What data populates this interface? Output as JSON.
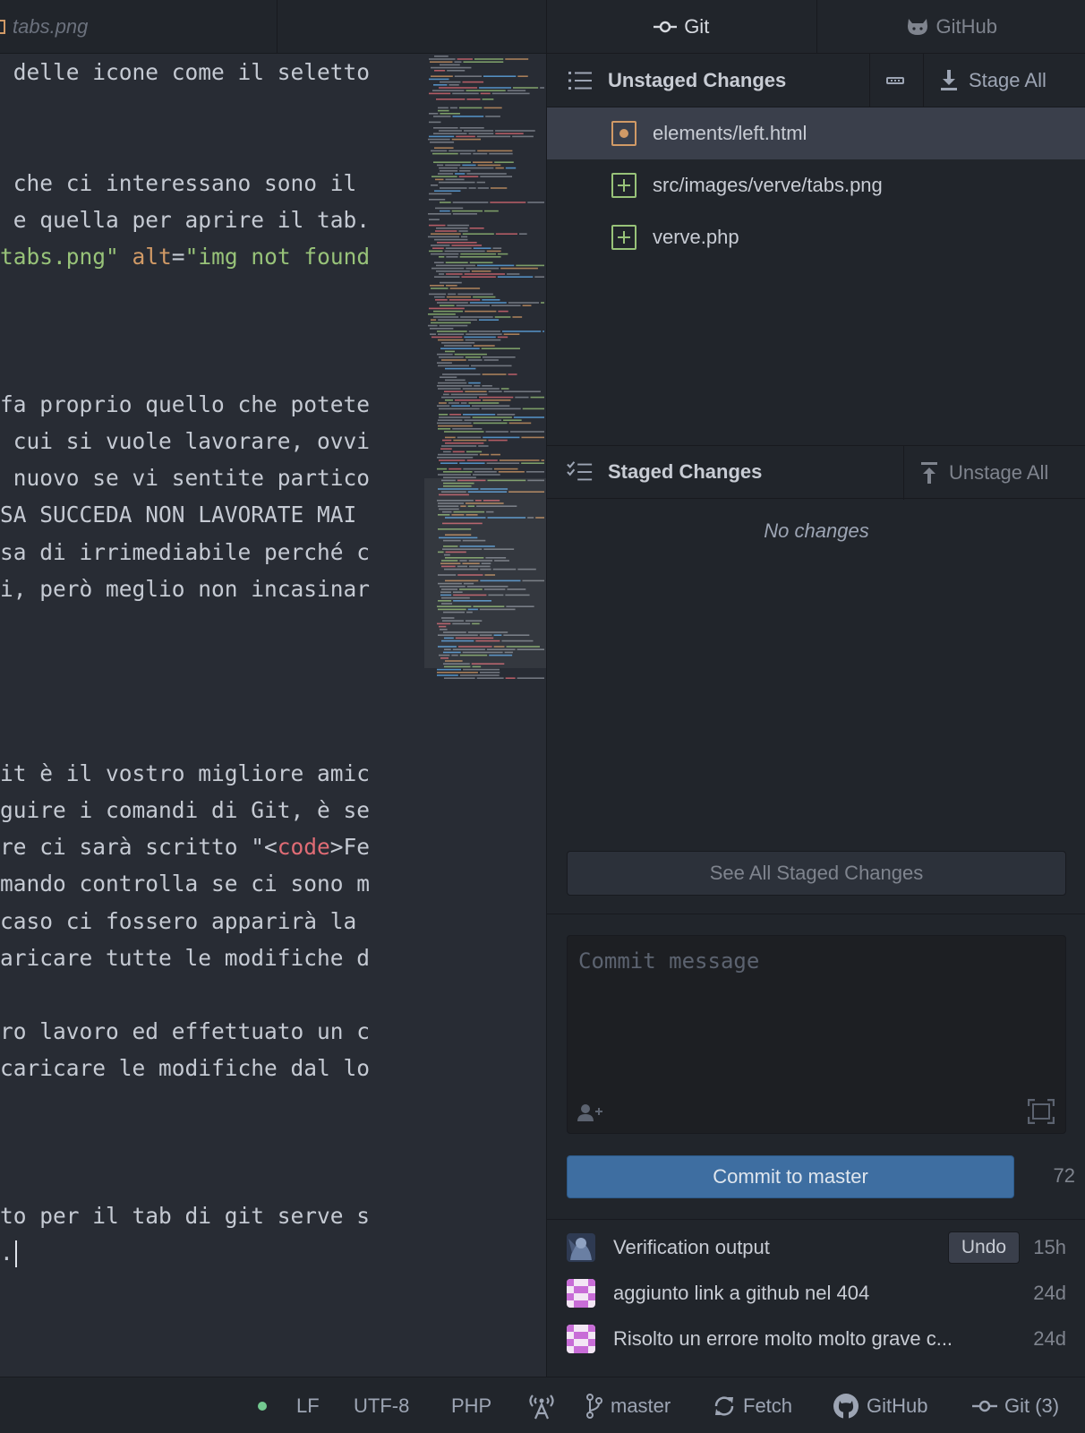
{
  "editor": {
    "tab_title": "tabs.png",
    "lines": [
      [
        {
          "t": " delle icone come il seletto",
          "c": "plain"
        }
      ],
      [
        {
          "t": "",
          "c": "plain"
        }
      ],
      [
        {
          "t": "",
          "c": "plain"
        }
      ],
      [
        {
          "t": " che ci interessano sono il ",
          "c": "plain"
        }
      ],
      [
        {
          "t": " e quella per aprire il tab.",
          "c": "plain"
        }
      ],
      [
        {
          "t": "tabs.png\"",
          "c": "green"
        },
        {
          "t": " ",
          "c": "plain"
        },
        {
          "t": "alt",
          "c": "orange"
        },
        {
          "t": "=",
          "c": "plain"
        },
        {
          "t": "\"img not found",
          "c": "green"
        }
      ],
      [
        {
          "t": "",
          "c": "plain"
        }
      ],
      [
        {
          "t": "",
          "c": "plain"
        }
      ],
      [
        {
          "t": "",
          "c": "plain"
        }
      ],
      [
        {
          "t": "fa proprio quello che potete",
          "c": "plain"
        }
      ],
      [
        {
          "t": " cui si vuole lavorare, ovvi",
          "c": "plain"
        }
      ],
      [
        {
          "t": " nuovo se vi sentite partico",
          "c": "plain"
        }
      ],
      [
        {
          "t": "SA SUCCEDA NON LAVORATE MAI ",
          "c": "plain"
        }
      ],
      [
        {
          "t": "sa di irrimediabile perché c",
          "c": "plain"
        }
      ],
      [
        {
          "t": "i, però meglio non incasinar",
          "c": "plain"
        }
      ],
      [
        {
          "t": "",
          "c": "plain"
        }
      ],
      [
        {
          "t": "",
          "c": "plain"
        }
      ],
      [
        {
          "t": "",
          "c": "plain"
        }
      ],
      [
        {
          "t": "",
          "c": "plain"
        }
      ],
      [
        {
          "t": "it è il vostro migliore amic",
          "c": "plain"
        }
      ],
      [
        {
          "t": "guire i comandi di Git, è se",
          "c": "plain"
        }
      ],
      [
        {
          "t": "re ci sarà scritto \"<",
          "c": "plain"
        },
        {
          "t": "code",
          "c": "red"
        },
        {
          "t": ">Fe",
          "c": "plain"
        }
      ],
      [
        {
          "t": "mando controlla se ci sono m",
          "c": "plain"
        }
      ],
      [
        {
          "t": "caso ci fossero apparirà la ",
          "c": "plain"
        }
      ],
      [
        {
          "t": "aricare tutte le modifiche d",
          "c": "plain"
        }
      ],
      [
        {
          "t": "",
          "c": "plain"
        }
      ],
      [
        {
          "t": "ro lavoro ed effettuato un c",
          "c": "plain"
        }
      ],
      [
        {
          "t": "caricare le modifiche dal lo",
          "c": "plain"
        }
      ],
      [
        {
          "t": "",
          "c": "plain"
        }
      ],
      [
        {
          "t": "",
          "c": "plain"
        }
      ],
      [
        {
          "t": "",
          "c": "plain"
        }
      ],
      [
        {
          "t": "to per il tab di git serve s",
          "c": "plain"
        }
      ],
      [
        {
          "t": ".",
          "c": "plain"
        }
      ]
    ]
  },
  "panel": {
    "tab_git": "Git",
    "tab_github": "GitHub"
  },
  "unstaged": {
    "title": "Unstaged Changes",
    "stage_all": "Stage All",
    "files": [
      {
        "name": "elements/left.html",
        "status": "modified"
      },
      {
        "name": "src/images/verve/tabs.png",
        "status": "added"
      },
      {
        "name": "verve.php",
        "status": "added"
      }
    ]
  },
  "staged": {
    "title": "Staged Changes",
    "unstage_all": "Unstage All",
    "empty": "No changes",
    "see_all": "See All Staged Changes"
  },
  "commit": {
    "placeholder": "Commit message",
    "button": "Commit to master",
    "remaining": "72"
  },
  "recent_commits": [
    {
      "message": "Verification output",
      "time": "15h",
      "undo": "Undo"
    },
    {
      "message": "aggiunto link a github nel 404",
      "time": "24d"
    },
    {
      "message": "Risolto un errore molto molto grave c...",
      "time": "24d"
    }
  ],
  "statusbar": {
    "line_ending": "LF",
    "encoding": "UTF-8",
    "grammar": "PHP",
    "branch": "master",
    "fetch": "Fetch",
    "github": "GitHub",
    "git": "Git (3)"
  },
  "colors": {
    "accent_blue": "#3e6ea1",
    "added_green": "#98c379",
    "modified_orange": "#d19a66",
    "status_dot": "#73c990"
  }
}
